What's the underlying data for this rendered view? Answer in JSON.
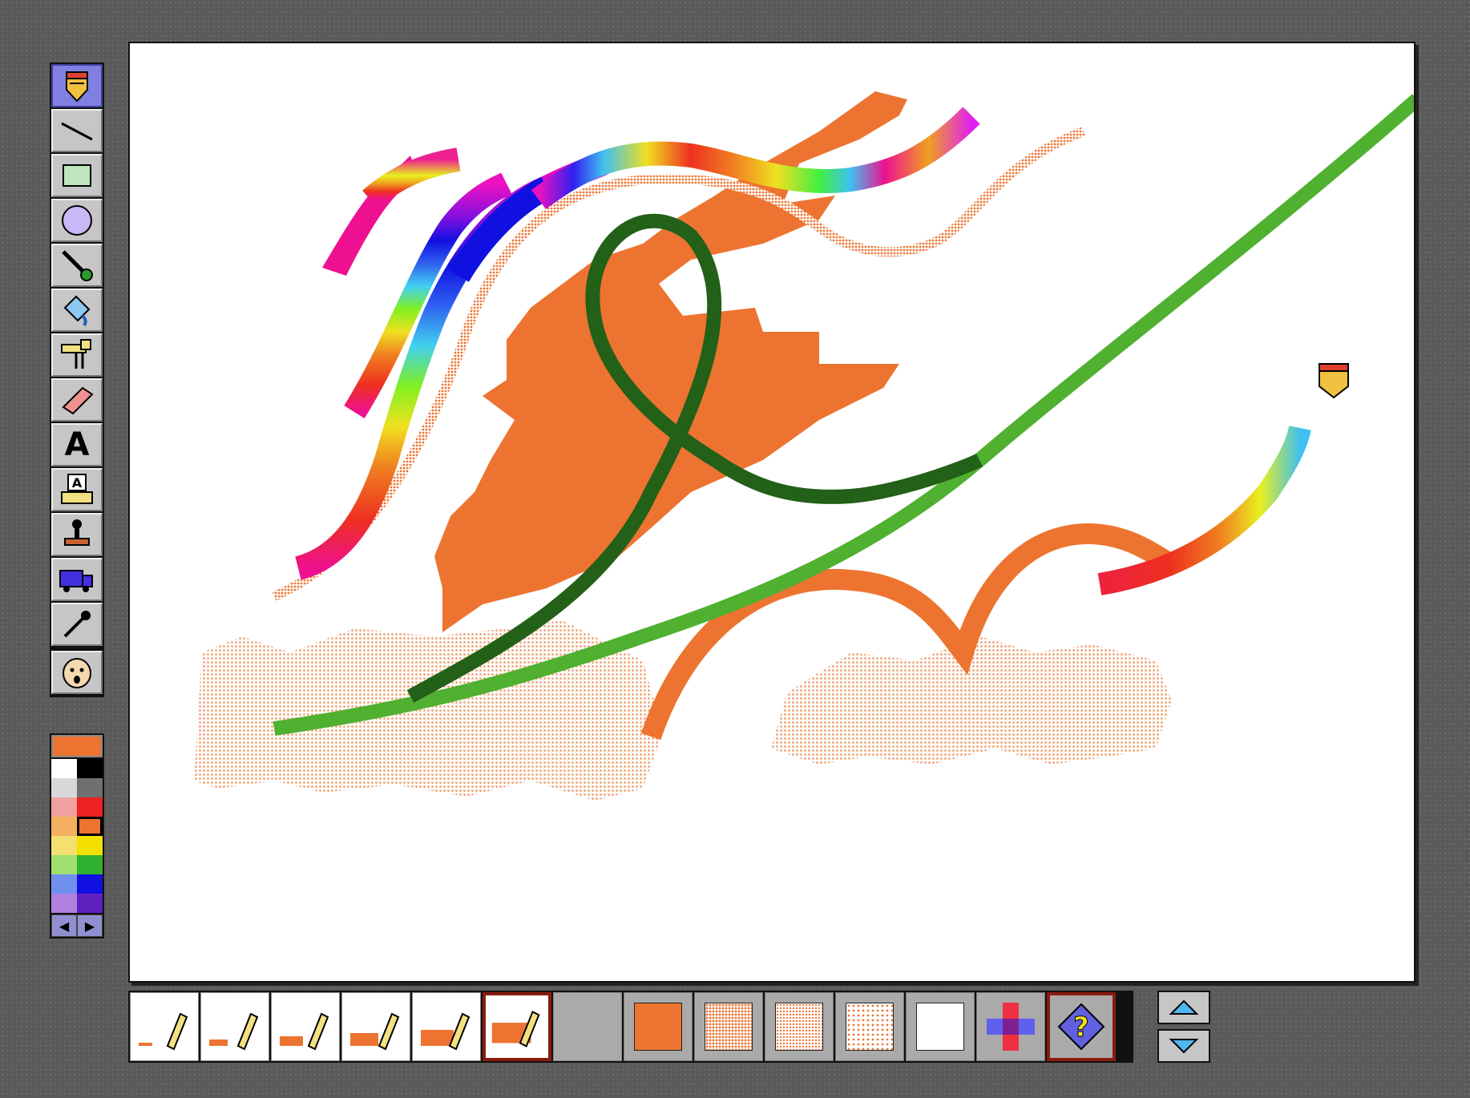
{
  "app": {
    "name": "paint program",
    "brush_color": "#ed7430",
    "canvas_bg": "#ffffff"
  },
  "tools": [
    {
      "name": "pencil-tool",
      "icon": "pencil-icon",
      "selected": true
    },
    {
      "name": "line-tool",
      "icon": "line-icon",
      "selected": false
    },
    {
      "name": "rectangle-tool",
      "icon": "rectangle-icon",
      "selected": false
    },
    {
      "name": "oval-tool",
      "icon": "oval-icon",
      "selected": false
    },
    {
      "name": "brush-tool",
      "icon": "paintbrush-icon",
      "selected": false
    },
    {
      "name": "paint-bucket-tool",
      "icon": "paint-bucket-icon",
      "selected": false
    },
    {
      "name": "wacky-brush-tool",
      "icon": "mixer-icon",
      "selected": false
    },
    {
      "name": "eraser-tool",
      "icon": "eraser-icon",
      "selected": false
    },
    {
      "name": "text-tool",
      "icon": "text-icon",
      "label": "A",
      "selected": false
    },
    {
      "name": "keyboard-tool",
      "icon": "keyboard-icon",
      "selected": false
    },
    {
      "name": "stamp-tool",
      "icon": "stamp-icon",
      "selected": false
    },
    {
      "name": "moving-van-tool",
      "icon": "truck-icon",
      "selected": false
    },
    {
      "name": "eyedropper-tool",
      "icon": "eyedropper-icon",
      "selected": false
    },
    {
      "name": "undo-guy-tool",
      "icon": "face-icon",
      "selected": false
    }
  ],
  "palette": {
    "current": "#ed7430",
    "colors": [
      "#ffffff",
      "#000000",
      "#d8d8d8",
      "#707070",
      "#f2a0a0",
      "#ee2020",
      "#f4b060",
      "#ed7430",
      "#f4e070",
      "#f4e000",
      "#a0e070",
      "#30b030",
      "#7090f0",
      "#1010e0",
      "#b080e0",
      "#6020c0"
    ],
    "selected_index": 7
  },
  "brush_sizes": [
    {
      "name": "brush-size-1",
      "width": 1
    },
    {
      "name": "brush-size-2",
      "width": 3
    },
    {
      "name": "brush-size-3",
      "width": 5
    },
    {
      "name": "brush-size-4",
      "width": 7
    },
    {
      "name": "brush-size-5",
      "width": 9
    },
    {
      "name": "brush-size-6",
      "width": 12,
      "selected": true
    }
  ],
  "fill_patterns": [
    {
      "name": "fill-solid",
      "pattern": "solid"
    },
    {
      "name": "fill-dense-dots",
      "pattern": "dense"
    },
    {
      "name": "fill-medium-dots",
      "pattern": "medium"
    },
    {
      "name": "fill-sparse-dots",
      "pattern": "sparse"
    },
    {
      "name": "fill-none",
      "pattern": "none"
    },
    {
      "name": "fill-mirror",
      "pattern": "mirror"
    },
    {
      "name": "fill-help",
      "pattern": "help",
      "label": "?",
      "selected": true
    }
  ]
}
